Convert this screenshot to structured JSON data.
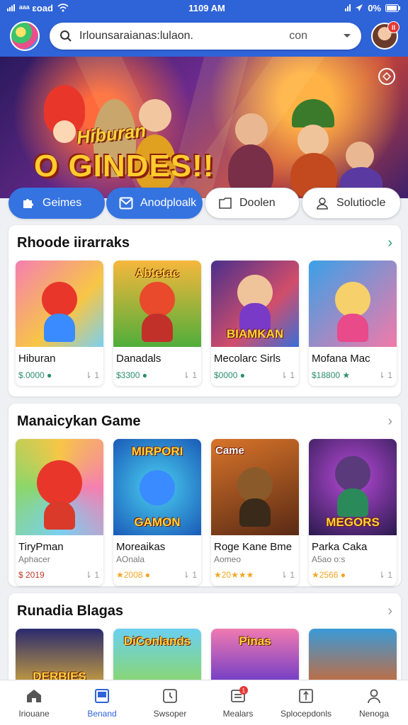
{
  "status_bar": {
    "carrier": "ᵃᵃᵃ ɛoad",
    "time": "1109 AM",
    "battery": "0%"
  },
  "header": {
    "search_query": "Irlounsaraianas:lulaon.",
    "search_suffix": "con",
    "notification_badge": "II"
  },
  "hero": {
    "brand_text": "Hiburan",
    "headline": "O GINDES!!"
  },
  "categories": [
    {
      "label": "Geimes",
      "active": true
    },
    {
      "label": "Anodploalk",
      "active": true
    },
    {
      "label": "Doolen",
      "active": false
    },
    {
      "label": "Solutiocle",
      "active": false
    }
  ],
  "sections": [
    {
      "title": "Rhoode iirarraks",
      "items": [
        {
          "name": "Hiburan",
          "price": "$.0000 ●",
          "rank": "1"
        },
        {
          "name": "Danadals",
          "price": "$3300 ●",
          "rank": "1",
          "thumb_text": "Abtetac"
        },
        {
          "name": "Mecolarc Sirls",
          "price": "$0000 ●",
          "rank": "1",
          "thumb_text": "BIAMKAN"
        },
        {
          "name": "Mofana Mac",
          "price": "$18800 ★",
          "rank": "1"
        }
      ]
    },
    {
      "title": "Manaicykan Game",
      "items": [
        {
          "name": "TiryPman",
          "sub": "Aphacer",
          "price": "$ 2019",
          "rank": "1"
        },
        {
          "name": "Moreaikas",
          "sub": "AOnala",
          "price": "★2008 ●",
          "rank": "1",
          "thumb_text_top": "MIRPORI",
          "thumb_text": "GAMON"
        },
        {
          "name": "Roge Kane Bme",
          "sub": "Aomeo",
          "price": "★20★★★",
          "rank": "1",
          "thumb_text_top": "Came"
        },
        {
          "name": "Parka Caka",
          "sub": "A5ao o:s",
          "price": "★2566 ●",
          "rank": "1",
          "thumb_text": "MEGORS"
        }
      ]
    },
    {
      "title": "Runadia Blagas",
      "items": [
        {
          "thumb_text": "DERBIES"
        },
        {
          "thumb_text_top": "DiConlands"
        },
        {
          "thumb_text_top": "Pinas"
        },
        {}
      ]
    }
  ],
  "bottom_nav": [
    {
      "label": "Iriouane",
      "icon": "home-icon"
    },
    {
      "label": "Benand",
      "icon": "tablet-icon",
      "active": true
    },
    {
      "label": "Swsoper",
      "icon": "clock-icon"
    },
    {
      "label": "Mealars",
      "icon": "list-icon",
      "badge": "1"
    },
    {
      "label": "Splocepdonls",
      "icon": "sparkle-icon"
    },
    {
      "label": "Nenoga",
      "icon": "person-icon"
    }
  ],
  "colors": {
    "primary": "#2f63d8",
    "pill_active": "#3573e0",
    "accent_green": "#28a36a"
  }
}
